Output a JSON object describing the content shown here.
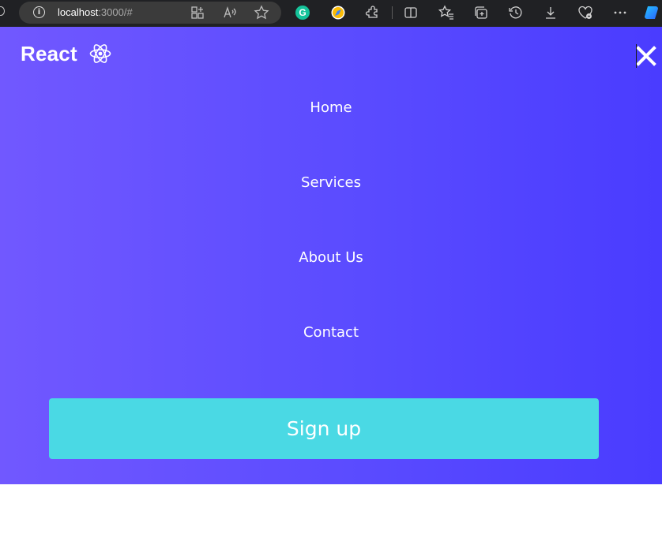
{
  "browser": {
    "url_host": "localhost",
    "url_path": ":3000/#",
    "toolbar_icons": [
      "split-screen-icon",
      "favorites-icon",
      "collections-icon",
      "history-icon",
      "downloads-icon",
      "browser-essentials-icon",
      "more-icon"
    ]
  },
  "app": {
    "brand": "React",
    "brand_icon": "react-atom-icon",
    "close_icon": "close-icon",
    "nav": [
      "Home",
      "Services",
      "About Us",
      "Contact"
    ],
    "cta": "Sign up",
    "colors": {
      "gradient_start": "#7158ff",
      "gradient_end": "#4a3cff",
      "cta_bg": "#4ad9e4",
      "text": "#ffffff"
    }
  }
}
